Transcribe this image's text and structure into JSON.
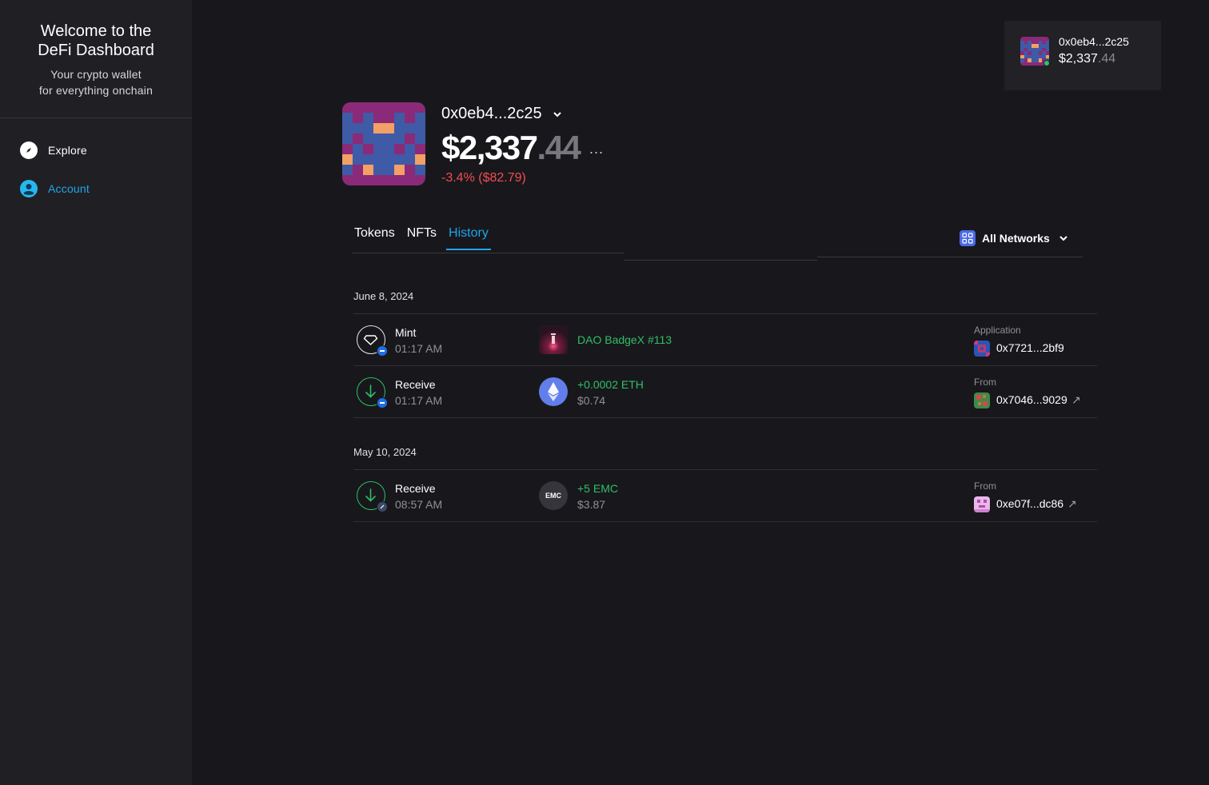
{
  "sidebar": {
    "title_line1": "Welcome to the",
    "title_line2": "DeFi Dashboard",
    "subtitle_line1": "Your crypto wallet",
    "subtitle_line2": "for everything onchain",
    "items": [
      {
        "label": "Explore",
        "icon": "compass-icon",
        "active": false
      },
      {
        "label": "Account",
        "icon": "user-icon",
        "active": true
      }
    ]
  },
  "top_card": {
    "address": "0x0eb4...2c25",
    "balance_whole": "$2,337",
    "balance_decimal": ".44",
    "status": "online"
  },
  "profile": {
    "address": "0x0eb4...2c25",
    "balance_whole": "$2,337",
    "balance_decimal": ".44",
    "more": "...",
    "change": "-3.4% ($82.79)"
  },
  "tabs": [
    {
      "label": "Tokens",
      "active": false
    },
    {
      "label": "NFTs",
      "active": false
    },
    {
      "label": "History",
      "active": true
    }
  ],
  "network_filter": {
    "label": "All Networks"
  },
  "history": [
    {
      "date": "June 8, 2024",
      "transactions": [
        {
          "type": "Mint",
          "time": "01:17 AM",
          "asset_main": "DAO BadgeX #113",
          "asset_sub": "",
          "counterparty_label": "Application",
          "counterparty": "0x7721...2bf9",
          "external_link": ""
        },
        {
          "type": "Receive",
          "time": "01:17 AM",
          "asset_main": "+0.0002 ETH",
          "asset_sub": "$0.74",
          "counterparty_label": "From",
          "counterparty": "0x7046...9029",
          "external_link": "↗"
        }
      ]
    },
    {
      "date": "May 10, 2024",
      "transactions": [
        {
          "type": "Receive",
          "time": "08:57 AM",
          "asset_main": "+5 EMC",
          "asset_sub": "$3.87",
          "asset_token_label": "EMC",
          "counterparty_label": "From",
          "counterparty": "0xe07f...dc86",
          "external_link": "↗"
        }
      ]
    }
  ],
  "colors": {
    "accent": "#1fa5ea",
    "positive": "#2fbf66",
    "negative": "#f24d52",
    "background": "#18181c",
    "sidebar": "#202024"
  }
}
